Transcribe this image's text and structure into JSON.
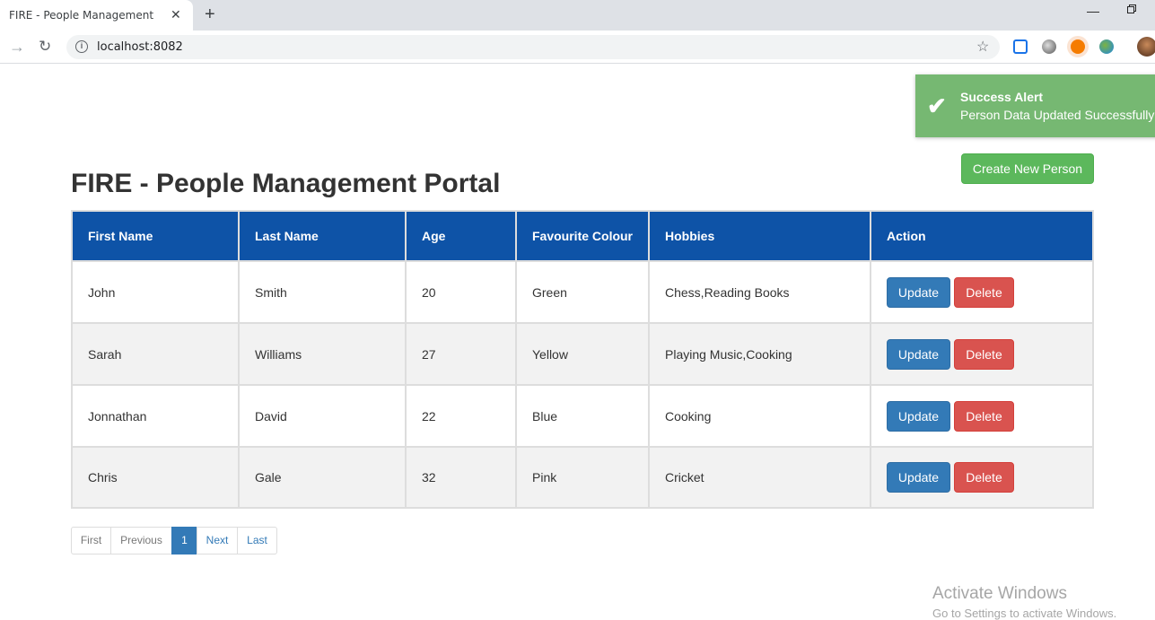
{
  "browser": {
    "tab_title": "FIRE - People Management",
    "close_glyph": "✕",
    "new_tab_glyph": "+",
    "minimize_glyph": "—",
    "url": "localhost:8082"
  },
  "alert": {
    "title": "Success Alert",
    "message": "Person Data Updated Successfully"
  },
  "page": {
    "title": "FIRE - People Management Portal",
    "create_button": "Create New Person"
  },
  "table": {
    "columns": [
      "First Name",
      "Last Name",
      "Age",
      "Favourite Colour",
      "Hobbies",
      "Action"
    ],
    "rows": [
      {
        "first": "John",
        "last": "Smith",
        "age": "20",
        "colour": "Green",
        "hobbies": "Chess,Reading Books"
      },
      {
        "first": "Sarah",
        "last": "Williams",
        "age": "27",
        "colour": "Yellow",
        "hobbies": "Playing Music,Cooking"
      },
      {
        "first": "Jonnathan",
        "last": "David",
        "age": "22",
        "colour": "Blue",
        "hobbies": "Cooking"
      },
      {
        "first": "Chris",
        "last": "Gale",
        "age": "32",
        "colour": "Pink",
        "hobbies": "Cricket"
      }
    ],
    "update_label": "Update",
    "delete_label": "Delete"
  },
  "pagination": {
    "first": "First",
    "previous": "Previous",
    "current": "1",
    "next": "Next",
    "last": "Last"
  },
  "watermark": {
    "line1": "Activate Windows",
    "line2": "Go to Settings to activate Windows."
  },
  "colors": {
    "header_bg": "#0e53a7",
    "alert_bg": "#76b872",
    "create_btn": "#5cb85c",
    "update_btn": "#337ab7",
    "delete_btn": "#d9534f"
  }
}
